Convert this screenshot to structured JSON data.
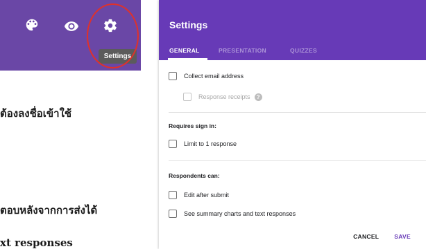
{
  "toolbar": {
    "icons": [
      "palette-icon",
      "eye-icon",
      "gear-icon"
    ],
    "tooltip": "Settings",
    "background": "#6a47a6",
    "highlight_color": "#e0312a"
  },
  "background_text": {
    "line1": "ต้องลงชื่อเข้าใช้",
    "line2": "ตอบหลังจากการส่งได้",
    "line3": "xt responses"
  },
  "dialog": {
    "title": "Settings",
    "accent": "#673ab7",
    "tabs": [
      {
        "label": "GENERAL",
        "active": true
      },
      {
        "label": "PRESENTATION",
        "active": false
      },
      {
        "label": "QUIZZES",
        "active": false
      }
    ],
    "collect_email": {
      "label": "Collect email address",
      "checked": false
    },
    "response_receipts": {
      "label": "Response receipts",
      "checked": false,
      "disabled": true
    },
    "help_glyph": "?",
    "requires_sign_in": {
      "title": "Requires sign in:",
      "limit_one": {
        "label": "Limit to 1 response",
        "checked": false
      }
    },
    "respondents_can": {
      "title": "Respondents can:",
      "edit_after_submit": {
        "label": "Edit after submit",
        "checked": false
      },
      "see_summary": {
        "label": "See summary charts and text responses",
        "checked": false
      }
    },
    "actions": {
      "cancel": "CANCEL",
      "save": "SAVE"
    }
  }
}
